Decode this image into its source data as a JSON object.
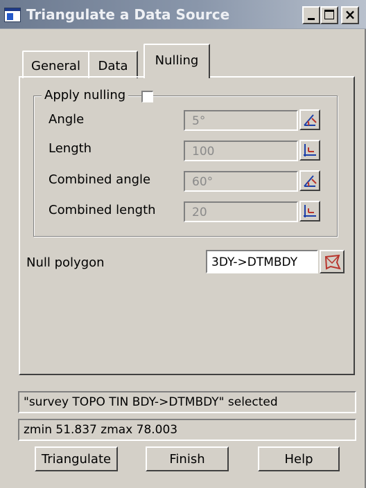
{
  "window": {
    "title": "Triangulate a Data Source",
    "controls": {
      "minimize": "_",
      "maximize": "□",
      "close": "×"
    }
  },
  "tabs": [
    {
      "label": "General",
      "active": false
    },
    {
      "label": "Data",
      "active": false
    },
    {
      "label": "Nulling",
      "active": true
    }
  ],
  "nulling": {
    "apply_label": "Apply nulling",
    "apply_checked": false,
    "rows": [
      {
        "label": "Angle",
        "value": "5°",
        "pick_icon": "angle-pick-icon"
      },
      {
        "label": "Length",
        "value": "100",
        "pick_icon": "length-pick-icon"
      },
      {
        "label": "Combined angle",
        "value": "60°",
        "pick_icon": "angle-pick-icon"
      },
      {
        "label": "Combined length",
        "value": "20",
        "pick_icon": "length-pick-icon"
      }
    ],
    "null_polygon_label": "Null polygon",
    "null_polygon_value": "3DY->DTMBDY",
    "null_polygon_icon": "polygon-select-icon"
  },
  "status": {
    "line1": "\"survey TOPO TIN BDY->DTMBDY\" selected",
    "line2": "zmin 51.837 zmax 78.003"
  },
  "buttons": {
    "triangulate": "Triangulate",
    "finish": "Finish",
    "help": "Help"
  },
  "colors": {
    "dialog_bg": "#d4d0c8",
    "titlebar_start": "#6c7a90",
    "titlebar_end": "#b9c1cd",
    "disabled_text": "#8a8a8a"
  }
}
